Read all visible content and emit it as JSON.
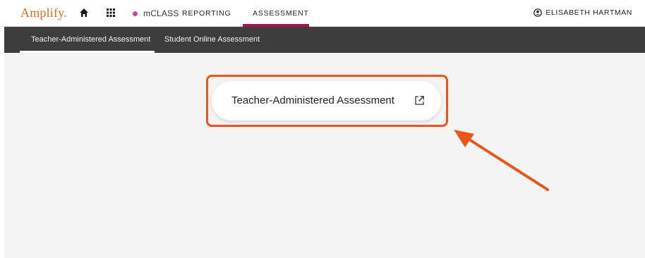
{
  "header": {
    "logo": "Amplify.",
    "home_icon": "home-icon",
    "apps_icon": "grid-icon",
    "product": {
      "label": "mCLASS",
      "dot_color": "#d1488f"
    },
    "nav": {
      "reporting": "REPORTING",
      "assessment": "ASSESSMENT",
      "active": "ASSESSMENT",
      "active_color": "#a7125a"
    },
    "user": {
      "icon": "user-circle-icon",
      "name": "ELISABETH HARTMAN"
    }
  },
  "subnav": {
    "tabs": [
      {
        "label": "Teacher-Administered Assessment",
        "active": true
      },
      {
        "label": "Student Online Assessment",
        "active": false
      }
    ]
  },
  "main": {
    "launch_button": {
      "label": "Teacher-Administered Assessment",
      "icon": "external-link-icon"
    },
    "annotation": {
      "color": "#e8561b",
      "shapes": [
        "highlight-box",
        "arrow"
      ]
    }
  },
  "colors": {
    "brand": "#e0691f",
    "subnav_bg": "#3d3d3d",
    "content_bg": "#f4f4f4"
  }
}
